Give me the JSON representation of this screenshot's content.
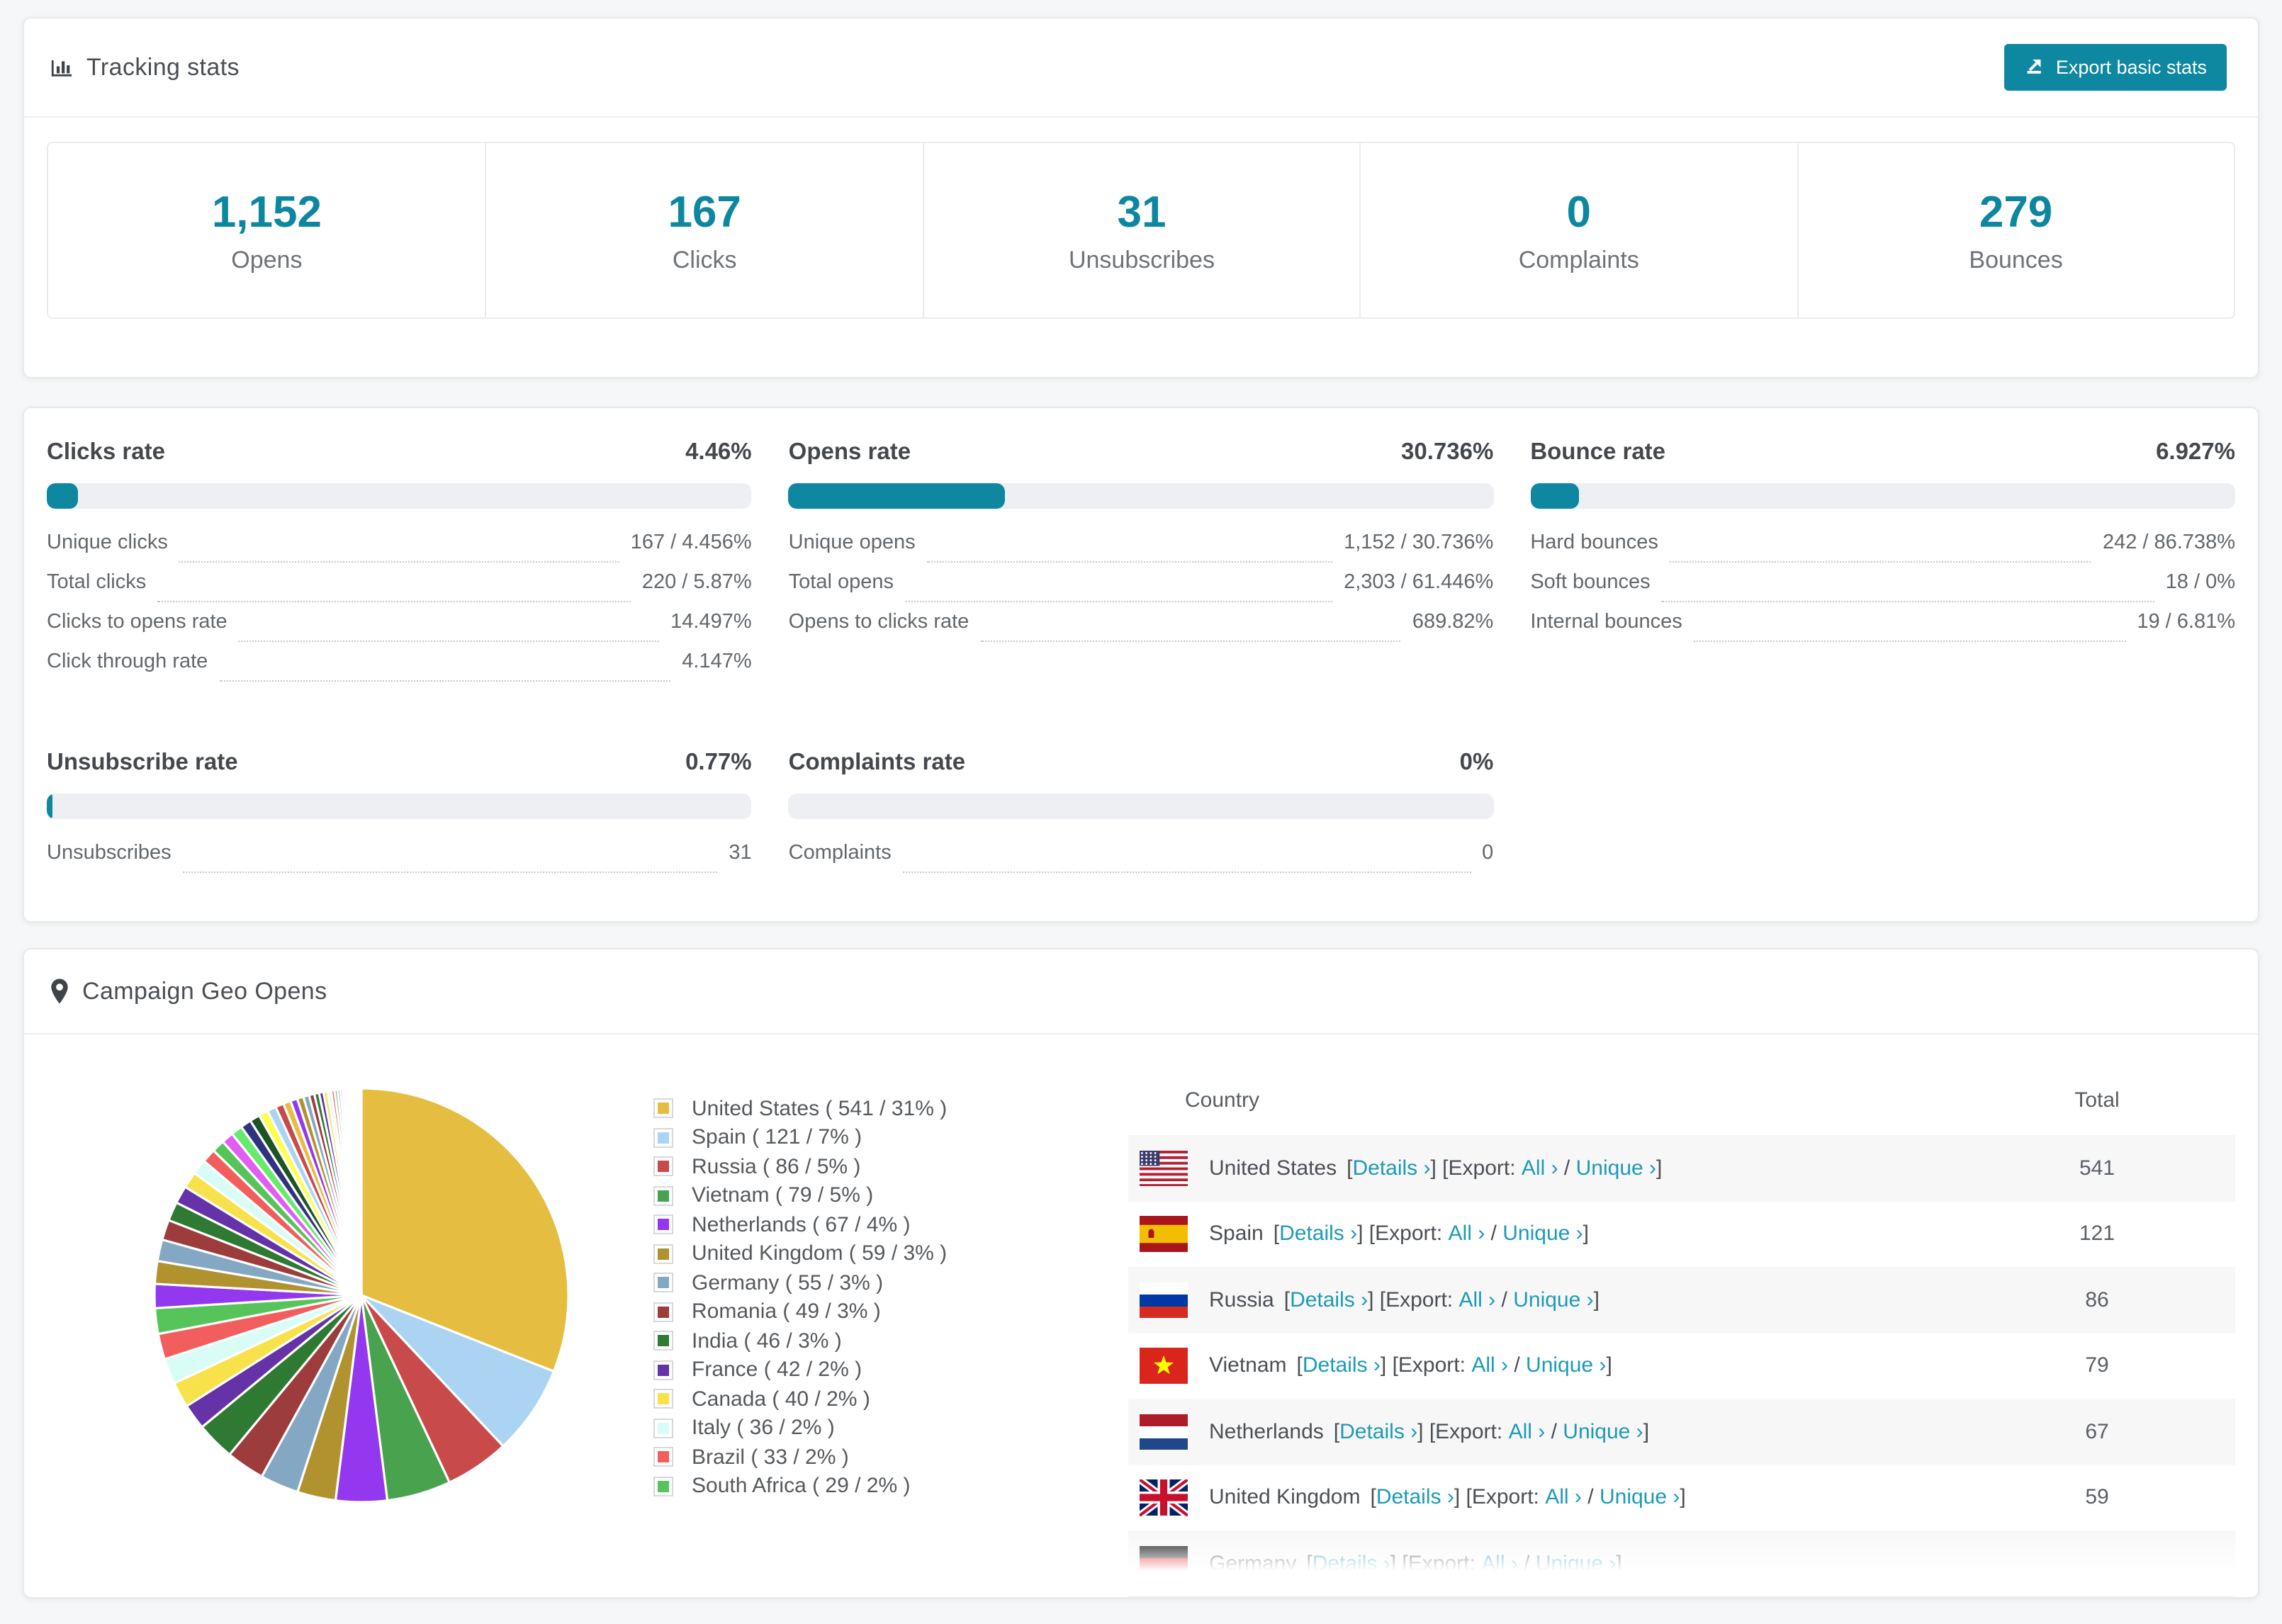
{
  "colors": {
    "accent_teal": "#0e87a0",
    "link_teal": "#1d9ab6",
    "progress_track": "#edeff2",
    "stat_number": "#0d87a0",
    "row_alt_bg": "#f7f7f8"
  },
  "tracking_stats": {
    "title": "Tracking stats",
    "export_button": "Export basic stats",
    "boxes": [
      {
        "value": "1,152",
        "label": "Opens"
      },
      {
        "value": "167",
        "label": "Clicks"
      },
      {
        "value": "31",
        "label": "Unsubscribes"
      },
      {
        "value": "0",
        "label": "Complaints"
      },
      {
        "value": "279",
        "label": "Bounces"
      }
    ]
  },
  "rates": {
    "cards": [
      {
        "title": "Clicks rate",
        "percent": "4.46%",
        "bar": 4.46,
        "rows": [
          {
            "label": "Unique clicks",
            "value": "167 / 4.456%"
          },
          {
            "label": "Total clicks",
            "value": "220 / 5.87%"
          },
          {
            "label": "Clicks to opens rate",
            "value": "14.497%"
          },
          {
            "label": "Click through rate",
            "value": "4.147%"
          }
        ]
      },
      {
        "title": "Opens rate",
        "percent": "30.736%",
        "bar": 30.736,
        "rows": [
          {
            "label": "Unique opens",
            "value": "1,152 / 30.736%"
          },
          {
            "label": "Total opens",
            "value": "2,303 / 61.446%"
          },
          {
            "label": "Opens to clicks rate",
            "value": "689.82%"
          }
        ]
      },
      {
        "title": "Bounce rate",
        "percent": "6.927%",
        "bar": 6.927,
        "rows": [
          {
            "label": "Hard bounces",
            "value": "242 / 86.738%"
          },
          {
            "label": "Soft bounces",
            "value": "18 / 0%"
          },
          {
            "label": "Internal bounces",
            "value": "19 / 6.81%"
          }
        ]
      },
      {
        "title": "Unsubscribe rate",
        "percent": "0.77%",
        "bar": 0.77,
        "rows": [
          {
            "label": "Unsubscribes",
            "value": "31"
          }
        ]
      },
      {
        "title": "Complaints rate",
        "percent": "0%",
        "bar": 0,
        "rows": [
          {
            "label": "Complaints",
            "value": "0"
          }
        ]
      }
    ]
  },
  "geo": {
    "title": "Campaign Geo Opens",
    "table": {
      "headers": [
        "Country",
        "Total"
      ],
      "links": {
        "bracket_l": "[",
        "bracket_r": "]",
        "details": "Details ›",
        "export_label": "Export: ",
        "all": "All ›",
        "slash": " / ",
        "unique": "Unique ›"
      },
      "rows": [
        {
          "country": "United States",
          "flag": "us",
          "total": "541"
        },
        {
          "country": "Spain",
          "flag": "es",
          "total": "121"
        },
        {
          "country": "Russia",
          "flag": "ru",
          "total": "86"
        },
        {
          "country": "Vietnam",
          "flag": "vn",
          "total": "79"
        },
        {
          "country": "Netherlands",
          "flag": "nl",
          "total": "67"
        },
        {
          "country": "United Kingdom",
          "flag": "gb",
          "total": "59"
        },
        {
          "country": "Germany",
          "flag": "de",
          "total": ""
        }
      ]
    }
  },
  "chart_data": {
    "type": "pie",
    "title": "Campaign Geo Opens",
    "value_unit": "opens",
    "start_angle_deg": -90,
    "direction": "clockwise",
    "legend_position": "right",
    "legend_format": "{label} ( {value} / {percent}% )",
    "series": [
      {
        "label": "United States",
        "value": 541,
        "percent": 31,
        "color": "#e4bd41"
      },
      {
        "label": "Spain",
        "value": 121,
        "percent": 7,
        "color": "#aad4f2"
      },
      {
        "label": "Russia",
        "value": 86,
        "percent": 5,
        "color": "#c94a4a"
      },
      {
        "label": "Vietnam",
        "value": 79,
        "percent": 5,
        "color": "#49a24d"
      },
      {
        "label": "Netherlands",
        "value": 67,
        "percent": 4,
        "color": "#9438ef"
      },
      {
        "label": "United Kingdom",
        "value": 59,
        "percent": 3,
        "color": "#b0922f"
      },
      {
        "label": "Germany",
        "value": 55,
        "percent": 3,
        "color": "#84a8c3"
      },
      {
        "label": "Romania",
        "value": 49,
        "percent": 3,
        "color": "#9d3c3c"
      },
      {
        "label": "India",
        "value": 46,
        "percent": 3,
        "color": "#2e7a33"
      },
      {
        "label": "France",
        "value": 42,
        "percent": 2,
        "color": "#6532a8"
      },
      {
        "label": "Canada",
        "value": 40,
        "percent": 2,
        "color": "#f7e24b"
      },
      {
        "label": "Italy",
        "value": 36,
        "percent": 2,
        "color": "#dafcf6"
      },
      {
        "label": "Brazil",
        "value": 33,
        "percent": 2,
        "color": "#f25e5e"
      },
      {
        "label": "South Africa",
        "value": 29,
        "percent": 2,
        "color": "#56c45b"
      }
    ],
    "others": {
      "percent_total": 26,
      "values": [
        1.9,
        1.8,
        1.7,
        1.6,
        1.5,
        1.4,
        1.3,
        1.2,
        1.1,
        1.0,
        0.95,
        0.9,
        0.85,
        0.8,
        0.75,
        0.7,
        0.65,
        0.6,
        0.55,
        0.5,
        0.46,
        0.42,
        0.38,
        0.35,
        0.32,
        0.29,
        0.26,
        0.24,
        0.22,
        0.2,
        0.18,
        0.16,
        0.14,
        0.13,
        0.12,
        0.11,
        0.1,
        0.09,
        0.08,
        0.07,
        0.06,
        0.05,
        0.05,
        0.04,
        0.04,
        0.03
      ],
      "palette": [
        "#9438ef",
        "#b0922f",
        "#84a8c3",
        "#9d3c3c",
        "#2e7a33",
        "#6532a8",
        "#f7e24b",
        "#dafcf6",
        "#f25e5e",
        "#56c45b",
        "#e25ef2",
        "#67ea6b",
        "#31327f",
        "#1c5423",
        "#fdff55",
        "#aad4f2",
        "#c94a4a",
        "#e4bd41"
      ]
    }
  }
}
